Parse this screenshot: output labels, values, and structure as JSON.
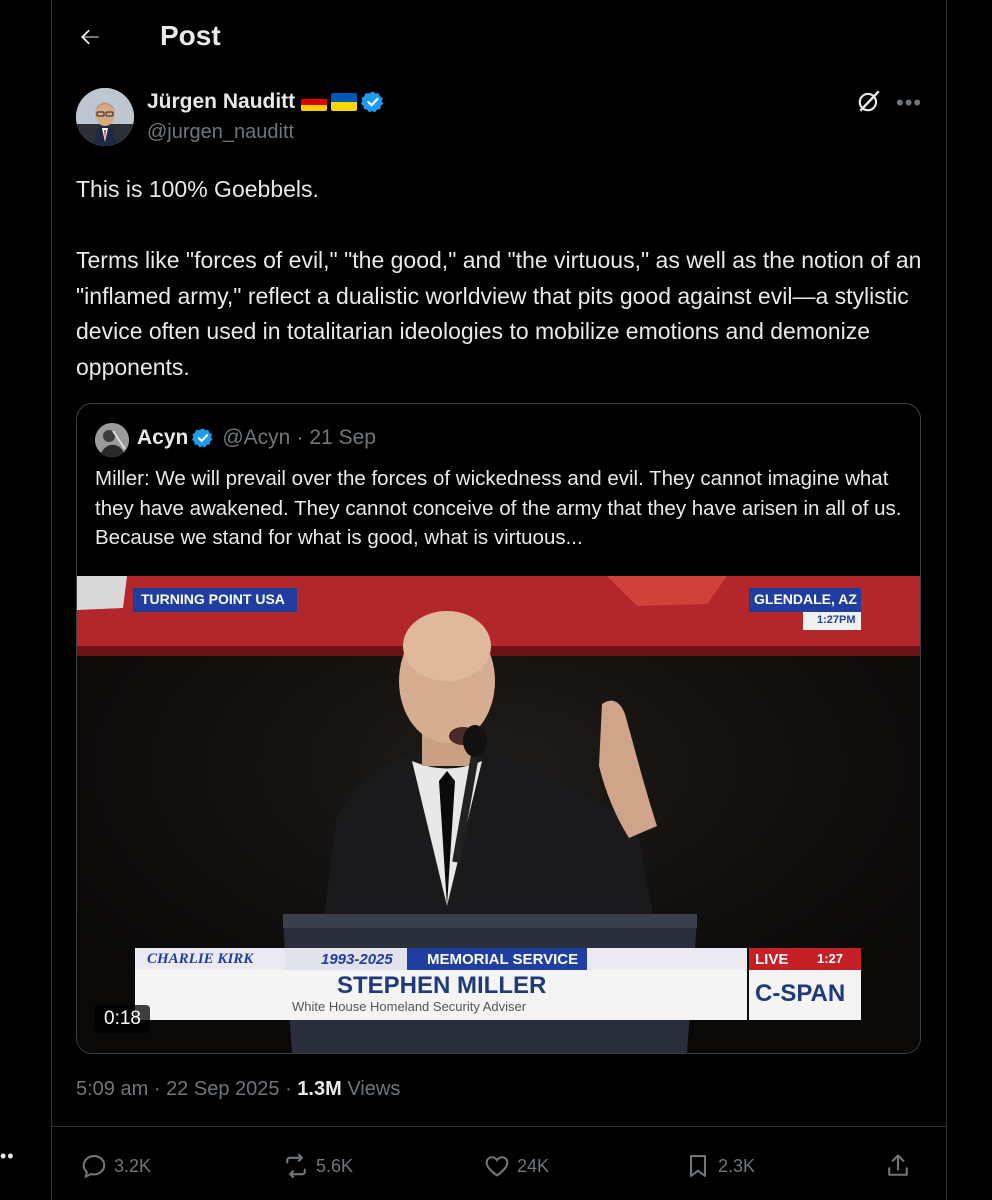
{
  "header": {
    "title": "Post"
  },
  "author": {
    "name": "Jürgen Nauditt",
    "handle": "@jurgen_nauditt"
  },
  "tweet": {
    "paragraphs": [
      "This is 100% Goebbels.",
      "Terms like \"forces of evil,\" \"the good,\" and \"the virtuous,\" as well as the notion of an \"inflamed army,\" reflect a dualistic worldview that pits good against evil—a stylistic device often used in totalitarian ideologies to mobilize emotions and demonize opponents."
    ]
  },
  "quote": {
    "name": "Acyn",
    "handle": "@Acyn",
    "separator": "·",
    "date": "21 Sep",
    "text": "Miller: We will prevail over the forces of wickedness and evil. They cannot imagine what they have awakened. They cannot conceive of the army that they have arisen in all of us. Because we stand for what is good, what is virtuous...",
    "video": {
      "duration": "0:18",
      "tag_left": "TURNING POINT USA",
      "tag_right": "GLENDALE, AZ",
      "tag_time": "1:27PM",
      "lower_third_name": "CHARLIE KIRK",
      "lower_third_years": "1993-2025",
      "lower_third_event": "MEMORIAL SERVICE",
      "speaker": "STEPHEN MILLER",
      "speaker_title": "White House Homeland Security Adviser",
      "live": "LIVE",
      "live_time": "1:27",
      "network": "C-SPAN"
    }
  },
  "meta": {
    "time": "5:09 am",
    "sep": "·",
    "date": "22 Sep 2025",
    "views_count": "1.3M",
    "views_label": "Views"
  },
  "actions": {
    "replies": "3.2K",
    "reposts": "5.6K",
    "likes": "24K",
    "bookmarks": "2.3K"
  },
  "colors": {
    "accent": "#1d9bf0",
    "muted": "#71767b",
    "text": "#e7e9ea",
    "background": "#000000"
  }
}
